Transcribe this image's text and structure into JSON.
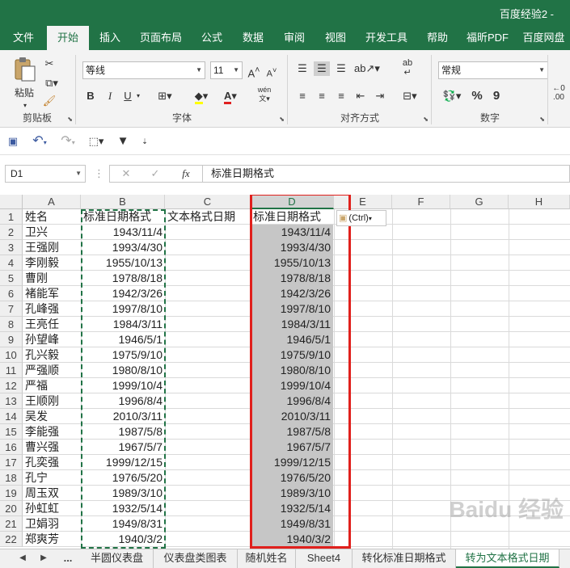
{
  "window": {
    "title": "百度经验2 -"
  },
  "ribbon_tabs": [
    "文件",
    "开始",
    "插入",
    "页面布局",
    "公式",
    "数据",
    "审阅",
    "视图",
    "开发工具",
    "帮助",
    "福昕PDF",
    "百度网盘"
  ],
  "active_tab": "开始",
  "clipboard": {
    "paste_label": "粘贴",
    "group_label": "剪贴板"
  },
  "font": {
    "name": "等线",
    "size": "11",
    "bold": "B",
    "italic": "I",
    "underline": "U",
    "grow": "A",
    "shrink": "A",
    "color_letter": "A",
    "wen": "wén",
    "group_label": "字体"
  },
  "alignment": {
    "group_label": "对齐方式"
  },
  "number": {
    "format": "常规",
    "percent": "%",
    "comma": "9",
    "group_label": "数字"
  },
  "formula_bar": {
    "name_box": "D1",
    "fx": "fx",
    "content": "标准日期格式"
  },
  "columns": [
    "A",
    "B",
    "C",
    "D",
    "E",
    "F",
    "G",
    "H"
  ],
  "selected_column": "D",
  "rows": [
    "1",
    "2",
    "3",
    "4",
    "5",
    "6",
    "7",
    "8",
    "9",
    "10",
    "11",
    "12",
    "13",
    "14",
    "15",
    "16",
    "17",
    "18",
    "19",
    "20",
    "21",
    "22"
  ],
  "headers": {
    "A": "姓名",
    "B": "标准日期格式",
    "C": "文本格式日期",
    "D": "标准日期格式"
  },
  "names": [
    "卫兴",
    "王强刚",
    "李刚毅",
    "曹刚",
    "褚能军",
    "孔峰强",
    "王亮任",
    "孙望峰",
    "孔兴毅",
    "严强顺",
    "严福",
    "王顺刚",
    "吴发",
    "李能强",
    "曹兴强",
    "孔奕强",
    "孔宁",
    "周玉双",
    "孙虹虹",
    "卫娟羽",
    "郑爽芳"
  ],
  "dates": [
    "1943/11/4",
    "1993/4/30",
    "1955/10/13",
    "1978/8/18",
    "1942/3/26",
    "1997/8/10",
    "1984/3/11",
    "1946/5/1",
    "1975/9/10",
    "1980/8/10",
    "1999/10/4",
    "1996/8/4",
    "2010/3/11",
    "1987/5/8",
    "1967/5/7",
    "1999/12/15",
    "1976/5/20",
    "1989/3/10",
    "1932/5/14",
    "1949/8/31",
    "1940/3/2"
  ],
  "paste_options": "(Ctrl)",
  "sheet_tabs": [
    "半圆仪表盘",
    "仪表盘类图表",
    "随机姓名",
    "Sheet4",
    "转化标准日期格式",
    "转为文本格式日期"
  ],
  "active_sheet": "转为文本格式日期",
  "sheet_ellipsis": "...",
  "watermark": "Baidu 经验"
}
